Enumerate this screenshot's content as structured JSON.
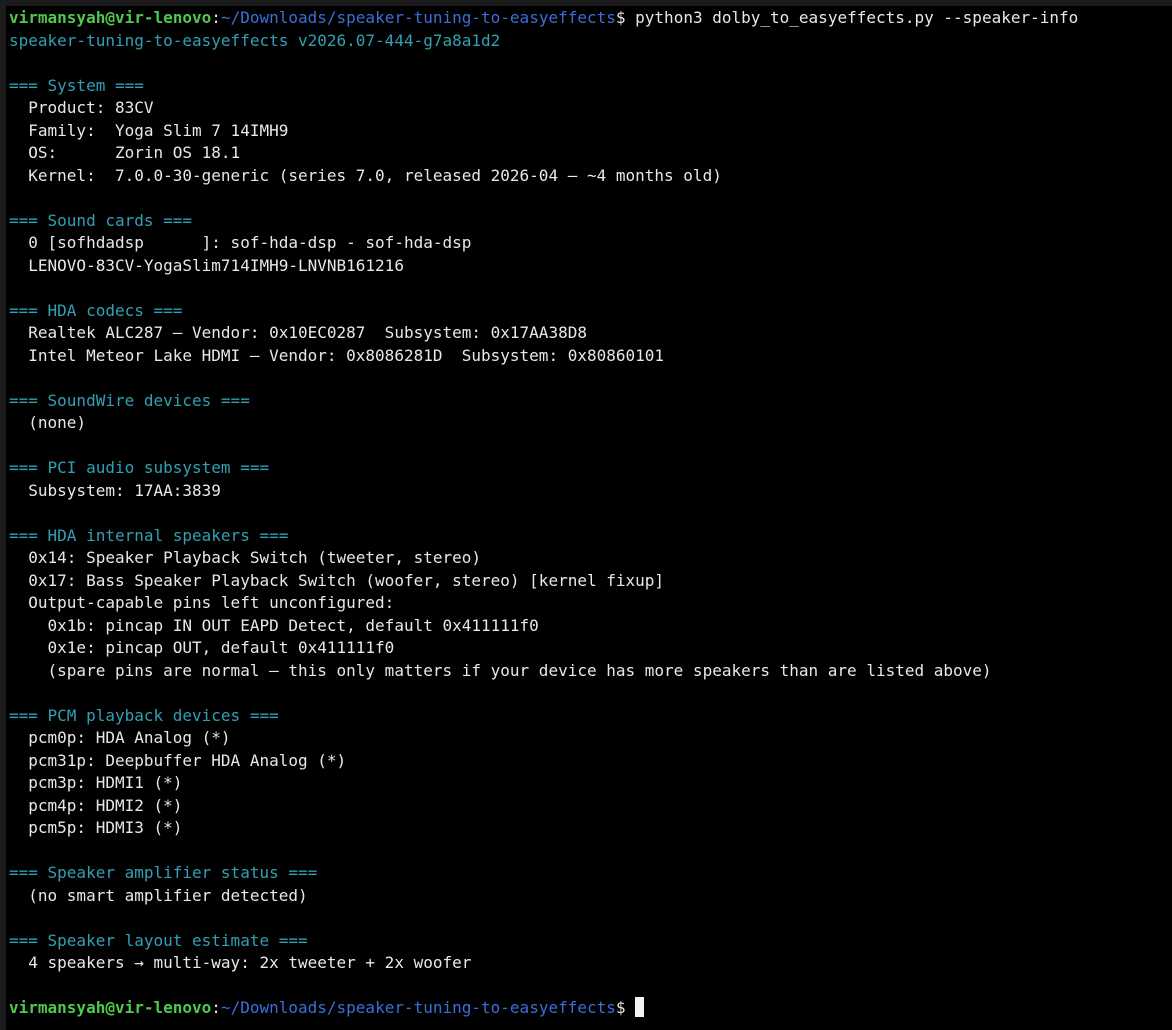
{
  "prompt": {
    "user_host": "virmansyah@vir-lenovo",
    "colon": ":",
    "path": "~/Downloads/speaker-tuning-to-easyeffects",
    "dollar": "$ "
  },
  "command": "python3 dolby_to_easyeffects.py --speaker-info",
  "version_line": "speaker-tuning-to-easyeffects v2026.07-444-g7a8a1d2",
  "sections": {
    "system": {
      "header": "=== System ===",
      "lines": [
        "  Product: 83CV",
        "  Family:  Yoga Slim 7 14IMH9",
        "  OS:      Zorin OS 18.1",
        "  Kernel:  7.0.0-30-generic (series 7.0, released 2026-04 — ~4 months old)"
      ]
    },
    "sound_cards": {
      "header": "=== Sound cards ===",
      "lines": [
        "  0 [sofhdadsp      ]: sof-hda-dsp - sof-hda-dsp",
        "  LENOVO-83CV-YogaSlim714IMH9-LNVNB161216"
      ]
    },
    "hda_codecs": {
      "header": "=== HDA codecs ===",
      "lines": [
        "  Realtek ALC287 — Vendor: 0x10EC0287  Subsystem: 0x17AA38D8",
        "  Intel Meteor Lake HDMI — Vendor: 0x8086281D  Subsystem: 0x80860101"
      ]
    },
    "soundwire": {
      "header": "=== SoundWire devices ===",
      "lines": [
        "  (none)"
      ]
    },
    "pci_audio": {
      "header": "=== PCI audio subsystem ===",
      "lines": [
        "  Subsystem: 17AA:3839"
      ]
    },
    "hda_speakers": {
      "header": "=== HDA internal speakers ===",
      "lines": [
        "  0x14: Speaker Playback Switch (tweeter, stereo)",
        "  0x17: Bass Speaker Playback Switch (woofer, stereo) [kernel fixup]",
        "  Output-capable pins left unconfigured:",
        "    0x1b: pincap IN OUT EAPD Detect, default 0x411111f0",
        "    0x1e: pincap OUT, default 0x411111f0",
        "    (spare pins are normal — this only matters if your device has more speakers than are listed above)"
      ]
    },
    "pcm_playback": {
      "header": "=== PCM playback devices ===",
      "lines": [
        "  pcm0p: HDA Analog (*)",
        "  pcm31p: Deepbuffer HDA Analog (*)",
        "  pcm3p: HDMI1 (*)",
        "  pcm4p: HDMI2 (*)",
        "  pcm5p: HDMI3 (*)"
      ]
    },
    "amplifier": {
      "header": "=== Speaker amplifier status ===",
      "lines": [
        "  (no smart amplifier detected)"
      ]
    },
    "layout": {
      "header": "=== Speaker layout estimate ===",
      "lines": [
        "  4 speakers → multi-way: 2x tweeter + 2x woofer"
      ]
    }
  },
  "colors": {
    "background": "#000000",
    "text": "#e8e8e8",
    "prompt_user_host": "#4ec94e",
    "prompt_path": "#3a6fd8",
    "section_header": "#31a0b4"
  }
}
